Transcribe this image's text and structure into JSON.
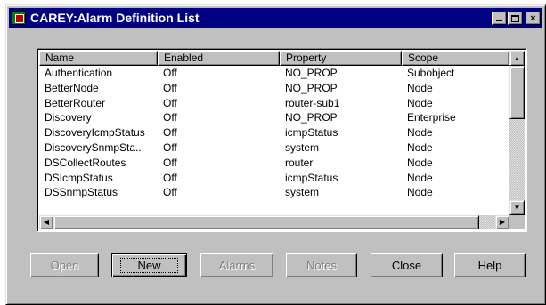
{
  "window": {
    "title": "CAREY:Alarm Definition List",
    "controls": {
      "minimize": "minimize-icon",
      "maximize": "maximize-icon",
      "close_glyph": "×"
    }
  },
  "list": {
    "columns": [
      "Name",
      "Enabled",
      "Property",
      "Scope"
    ],
    "rows": [
      [
        "Authentication",
        "Off",
        "NO_PROP",
        "Subobject"
      ],
      [
        "BetterNode",
        "Off",
        "NO_PROP",
        "Node"
      ],
      [
        "BetterRouter",
        "Off",
        "router-sub1",
        "Node"
      ],
      [
        "Discovery",
        "Off",
        "NO_PROP",
        "Enterprise"
      ],
      [
        "DiscoveryIcmpStatus",
        "Off",
        "icmpStatus",
        "Node"
      ],
      [
        "DiscoverySnmpSta...",
        "Off",
        "system",
        "Node"
      ],
      [
        "DSCollectRoutes",
        "Off",
        "router",
        "Node"
      ],
      [
        "DSIcmpStatus",
        "Off",
        "icmpStatus",
        "Node"
      ],
      [
        "DSSnmpStatus",
        "Off",
        "system",
        "Node"
      ]
    ]
  },
  "scroll_glyphs": {
    "up": "▲",
    "down": "▼",
    "left": "◀",
    "right": "▶"
  },
  "buttons": {
    "open": "Open",
    "new": "New",
    "alarms": "Alarms",
    "notes": "Notes",
    "close": "Close",
    "help": "Help"
  },
  "colors": {
    "titlebar": "#000080",
    "face": "#c0c0c0",
    "disabled_text": "#808080"
  }
}
